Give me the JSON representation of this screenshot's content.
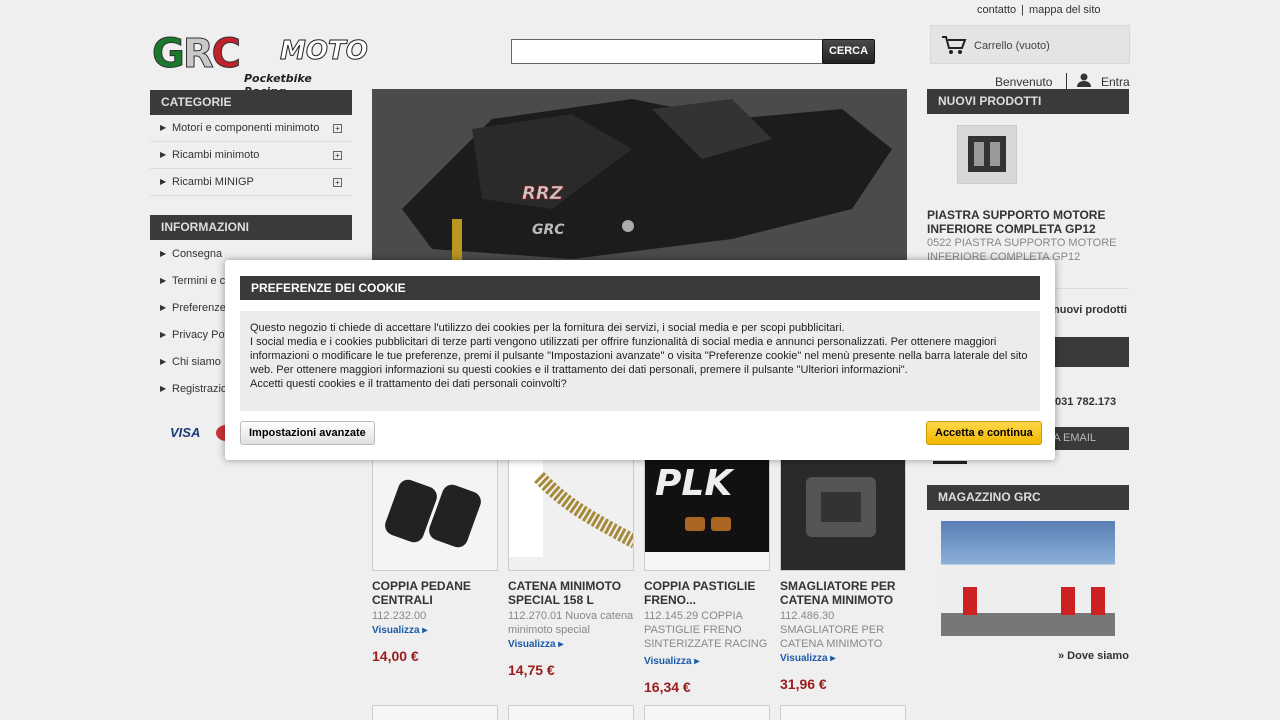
{
  "header": {
    "top_links": [
      "contatto",
      "mappa del sito"
    ],
    "logo": {
      "letters": [
        "G",
        "R",
        "C"
      ],
      "moto": "MOTO",
      "tagline": "Pocketbike  Racing"
    },
    "search": {
      "value": "",
      "placeholder": "",
      "button": "CERCA"
    },
    "cart_label": "Carrello (vuoto)",
    "welcome": "Benvenuto",
    "login": "Entra"
  },
  "left": {
    "categories_title": "CATEGORIE",
    "categories": [
      {
        "label": "Motori e componenti minimoto"
      },
      {
        "label": "Ricambi minimoto"
      },
      {
        "label": "Ricambi MINIGP"
      }
    ],
    "info_title": "INFORMAZIONI",
    "info": [
      {
        "label": "Consegna"
      },
      {
        "label": "Termini e c"
      },
      {
        "label": "Preferenze"
      },
      {
        "label": "Privacy Po"
      },
      {
        "label": "Chi siamo"
      },
      {
        "label": "Registrazio"
      }
    ],
    "payment": [
      "VISA"
    ]
  },
  "products": [
    {
      "name": "COPPIA PEDANE CENTRALI",
      "desc": "112.232.00",
      "view": "Visualizza",
      "price": "14,00 €"
    },
    {
      "name": "CATENA MINIMOTO SPECIAL 158 L",
      "desc": "112.270.01 Nuova catena minimoto special",
      "view": "Visualizza",
      "price": "14,75 €"
    },
    {
      "name": "COPPIA PASTIGLIE FRENO...",
      "desc": "112.145.29 COPPIA PASTIGLIE FRENO SINTERIZZATE RACING",
      "view": "Visualizza",
      "price": "16,34 €"
    },
    {
      "name": "SMAGLIATORE PER CATENA MINIMOTO",
      "desc": "112.486.30  SMAGLIATORE  PER CATENA  MINIMOTO",
      "view": "Visualizza",
      "price": "31,96 €"
    }
  ],
  "right": {
    "new_title": "NUOVI PRODOTTI",
    "new_name": "PIASTRA SUPPORTO MOTORE INFERIORE COMPLETA GP12",
    "new_desc": "0522  PIASTRA SUPPORTO MOTORE INFERIORE COMPLETA GP12",
    "all_new": "nuovi prodotti",
    "phone": "031 782.173",
    "email_btn": "A EMAIL",
    "warehouse_title": "MAGAZZINO GRC",
    "where": "» Dove siamo"
  },
  "cookie": {
    "title": "PREFERENZE DEI COOKIE",
    "lines": [
      "Questo negozio ti chiede di accettare l'utilizzo dei cookies per la fornitura dei servizi, i social media e per scopi pubblicitari.",
      "I social media e i cookies pubblicitari di terze parti vengono utilizzati per offrire funzionalità di social media e annunci personalizzati. Per ottenere maggiori informazioni o modificare le tue preferenze, premi il pulsante \"Impostazioni avanzate\" o visita \"Preferenze cookie\" nel menù presente nella barra laterale del sito web. Per ottenere maggiori informazioni su questi cookies e il trattamento dei dati personali, premere il pulsante \"Ulteriori informazioni\".",
      "Accetti questi cookies e il trattamento dei dati personali coinvolti?"
    ],
    "advanced_btn": "Impostazioni avanzate",
    "accept_btn": "Accetta e continua"
  }
}
